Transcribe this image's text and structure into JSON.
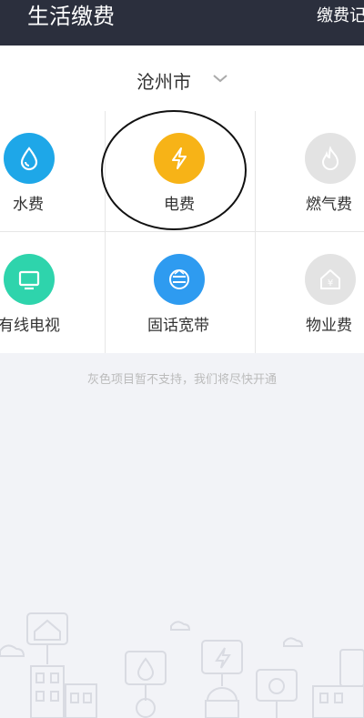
{
  "header": {
    "title": "生活缴费",
    "right_label": "缴费记录"
  },
  "city": {
    "name": "沧州市"
  },
  "services": [
    {
      "label": "水费",
      "color": "#1ea7e8",
      "icon": "water-drop-icon"
    },
    {
      "label": "电费",
      "color": "#f7b317",
      "icon": "lightning-icon"
    },
    {
      "label": "燃气费",
      "color": "#e3e3e3",
      "icon": "flame-icon"
    },
    {
      "label": "有线电视",
      "color": "#2ed4ac",
      "icon": "tv-icon"
    },
    {
      "label": "固话宽带",
      "color": "#2e9bf0",
      "icon": "broadband-icon"
    },
    {
      "label": "物业费",
      "color": "#e3e3e3",
      "icon": "house-icon"
    }
  ],
  "note": "灰色项目暂不支持，我们将尽快开通"
}
